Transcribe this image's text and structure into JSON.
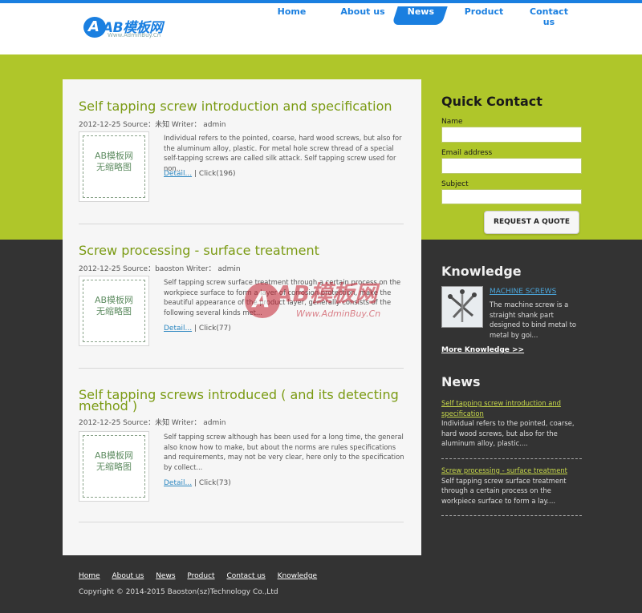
{
  "header": {
    "logo_text": "AB模板网",
    "logo_sub": "Www.AdminBuy.Cn",
    "nav": [
      "Home",
      "About us",
      "News",
      "Product",
      "Contact us"
    ],
    "active": "News"
  },
  "articles": [
    {
      "title": "Self tapping screw introduction and specification",
      "meta": "2012-12-25 Source：未知 Writer： admin",
      "thumb": [
        "AB模板网",
        "无缩略图"
      ],
      "excerpt": "Individual refers to the pointed, coarse, hard wood screws, but also for the aluminum alloy, plastic. For metal hole screw thread of a special self-tapping screws are called silk attack. Self tapping screw used for non...",
      "detail_label": "Detail...",
      "clicks": "| Click(196)"
    },
    {
      "title": "Screw processing - surface treatment",
      "meta": "2012-12-25 Source：baoston Writer： admin",
      "thumb": [
        "AB模板网",
        "无缩略图"
      ],
      "excerpt": "Self tapping screw surface treatment through a certain process on the workpiece surface to form a layer of corrosion protection, make the beautiful appearance of the product layer, generally consists of the following several kinds met...",
      "detail_label": "Detail...",
      "clicks": "| Click(77)"
    },
    {
      "title": "Self tapping screws introduced ( and its detecting method )",
      "meta": "2012-12-25 Source：未知 Writer： admin",
      "thumb": [
        "AB模板网",
        "无缩略图"
      ],
      "excerpt": "Self tapping screw although has been used for a long time, the general also know how to make, but about the norms are rules specifications and requirements, may not be very clear, here only to the specification by collect...",
      "detail_label": "Detail...",
      "clicks": "| Click(73)"
    }
  ],
  "watermark": {
    "text": "AB模板网",
    "sub": "Www.AdminBuy.Cn"
  },
  "quick_contact": {
    "title": "Quick Contact",
    "name_label": "Name",
    "email_label": "Email address",
    "subject_label": "Subject",
    "button": "REQUEST A QUOTE"
  },
  "knowledge": {
    "title": "Knowledge",
    "item_title": "MACHINE SCREWS",
    "item_text": "The machine screw is a straight shank part designed to bind metal to metal by goi...",
    "more": "More Knowledge >>"
  },
  "news": {
    "title": "News",
    "items": [
      {
        "title": "Self tapping screw introduction and specification",
        "text": "Individual refers to the pointed, coarse, hard wood screws, but also for the aluminum alloy, plastic...."
      },
      {
        "title": "Screw processing - surface treatment",
        "text": "Self tapping screw surface treatment through a certain process on the workpiece surface to form a lay...."
      }
    ]
  },
  "footer": {
    "links": [
      "Home",
      "About us",
      "News",
      "Product",
      "Contact us",
      "Knowledge"
    ],
    "copyright": "Copyright © 2014-2015 Baoston(sz)Technology Co.,Ltd"
  },
  "colors": {
    "brand_blue": "#1a7fe0",
    "band_green": "#afc62a",
    "title_green": "#7a9a12",
    "dark_bg": "#333333"
  }
}
